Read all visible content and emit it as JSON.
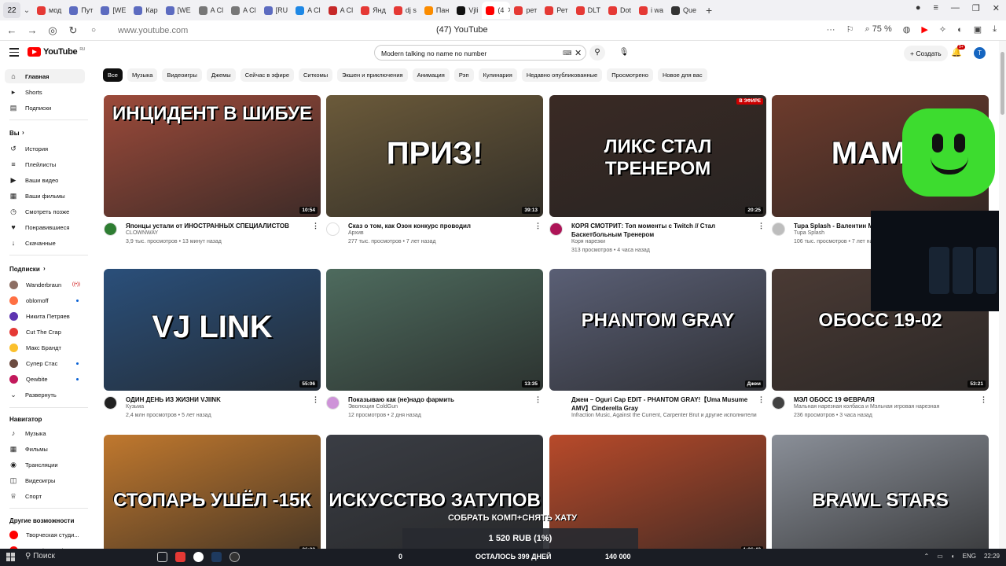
{
  "tabs": {
    "count": "22",
    "items": [
      {
        "label": "мод",
        "color": "#e53935"
      },
      {
        "label": "Пут",
        "color": "#5c6bc0"
      },
      {
        "label": "[WE",
        "color": "#5c6bc0"
      },
      {
        "label": "Кар",
        "color": "#5c6bc0"
      },
      {
        "label": "[WE",
        "color": "#5c6bc0"
      },
      {
        "label": "A Cl",
        "color": "#777777"
      },
      {
        "label": "A Cl",
        "color": "#777777"
      },
      {
        "label": "[RU",
        "color": "#5c6bc0"
      },
      {
        "label": "A Cl",
        "color": "#1e88e5"
      },
      {
        "label": "A Cl",
        "color": "#c62828"
      },
      {
        "label": "Янд",
        "color": "#e53935"
      },
      {
        "label": "dj s",
        "color": "#e53935"
      },
      {
        "label": "Пан",
        "color": "#fb8c00"
      },
      {
        "label": "Vjli",
        "color": "#111111"
      }
    ],
    "active": {
      "label": "(4",
      "color": "#ff0000"
    },
    "after": [
      {
        "label": "рет",
        "color": "#e53935"
      },
      {
        "label": "Рет",
        "color": "#e53935"
      },
      {
        "label": "DLT",
        "color": "#e53935"
      },
      {
        "label": "Dot",
        "color": "#e53935"
      },
      {
        "label": "i wa",
        "color": "#e53935"
      },
      {
        "label": "Que",
        "color": "#333333"
      }
    ]
  },
  "browser": {
    "url": "www.youtube.com",
    "page_title": "(47) YouTube",
    "zoom": "75 %",
    "bookmark_icon": "bookmark-icon"
  },
  "youtube": {
    "logo_text": "YouTube",
    "region": "RU",
    "search_value": "Modern talking no name no number",
    "create_label": "Создать",
    "notifications": "9+",
    "avatar_letter": "T"
  },
  "sidebar": {
    "main": [
      {
        "label": "Главная",
        "icon": "home-icon",
        "glyph": "⌂"
      },
      {
        "label": "Shorts",
        "icon": "shorts-icon",
        "glyph": "▸"
      },
      {
        "label": "Подписки",
        "icon": "subscriptions-icon",
        "glyph": "▤"
      }
    ],
    "you_title": "Вы",
    "you": [
      {
        "label": "История",
        "icon": "history-icon",
        "glyph": "↺"
      },
      {
        "label": "Плейлисты",
        "icon": "playlists-icon",
        "glyph": "≡"
      },
      {
        "label": "Ваши видео",
        "icon": "your-videos-icon",
        "glyph": "▶"
      },
      {
        "label": "Ваши фильмы",
        "icon": "your-movies-icon",
        "glyph": "▦"
      },
      {
        "label": "Смотреть позже",
        "icon": "watch-later-icon",
        "glyph": "◷"
      },
      {
        "label": "Понравившиеся",
        "icon": "like-icon",
        "glyph": "♥"
      },
      {
        "label": "Скачанные",
        "icon": "download-icon",
        "glyph": "↓"
      }
    ],
    "subs_title": "Подписки",
    "subs": [
      {
        "label": "Wanderbraun",
        "color": "#8d6e63",
        "status": "live"
      },
      {
        "label": "oblomoff",
        "color": "#ff7043",
        "status": "new"
      },
      {
        "label": "Никита Петряев",
        "color": "#5e35b1",
        "status": ""
      },
      {
        "label": "Cut The Crap",
        "color": "#e53935",
        "status": ""
      },
      {
        "label": "Макс Брандт",
        "color": "#fbc02d",
        "status": ""
      },
      {
        "label": "Супер Стас",
        "color": "#6d4c41",
        "status": "new"
      },
      {
        "label": "Qewbite",
        "color": "#c2185b",
        "status": "new"
      }
    ],
    "expand_label": "Развернуть",
    "nav_title": "Навигатор",
    "nav": [
      {
        "label": "Музыка",
        "icon": "music-icon",
        "glyph": "♪"
      },
      {
        "label": "Фильмы",
        "icon": "movies-icon",
        "glyph": "▦"
      },
      {
        "label": "Трансляции",
        "icon": "live-icon",
        "glyph": "◉"
      },
      {
        "label": "Видеоигры",
        "icon": "gaming-icon",
        "glyph": "◫"
      },
      {
        "label": "Спорт",
        "icon": "sport-icon",
        "glyph": "♕"
      }
    ],
    "more_title": "Другие возможности",
    "more": [
      {
        "label": "Творческая студи...",
        "color": "#ff0000"
      },
      {
        "label": "YouTube Music",
        "color": "#ff0000"
      }
    ]
  },
  "chips": [
    "Все",
    "Музыка",
    "Видеоигры",
    "Джемы",
    "Сейчас в эфире",
    "Ситкомы",
    "Экшен и приключения",
    "Анимация",
    "Рэп",
    "Кулинария",
    "Недавно опубликованные",
    "Просмотрено",
    "Новое для вас"
  ],
  "videos": [
    {
      "title": "Японцы устали от ИНОСТРАННЫХ СПЕЦИАЛИСТОВ",
      "channel": "CLOWNWAY",
      "stats": "3,9 тыс. просмотров • 13 минут назад",
      "duration": "10:54",
      "thumb_text": "ИНЦИДЕНТ В ШИБУЕ",
      "bg": "#9c4a3a",
      "avatar": "#2e7d32"
    },
    {
      "title": "Сказ о том, как Озон конкурс проводил",
      "channel": "Архив",
      "stats": "277 тыс. просмотров • 7 лет назад",
      "duration": "39:13",
      "thumb_text": "ПРИЗ!",
      "bg": "#6b5a3a",
      "avatar": "#ffffff"
    },
    {
      "title": "КОРЯ СМОТРИТ: Топ моменты с Twitch // Стал Баскетбольным Тренером",
      "channel": "Коря нарезки",
      "stats": "313 просмотров • 4 часа назад",
      "duration": "20:25",
      "thumb_text": "ЛИКС СТАЛ ТРЕНЕРОМ",
      "bg": "#3a2a24",
      "avatar": "#ad1457",
      "live": "В ЭФИРЕ"
    },
    {
      "title": "Tupa Splash - Валентин Мам",
      "channel": "Tupa Splash",
      "stats": "106 тыс. просмотров • 7 лет наз",
      "duration": "",
      "thumb_text": "МАМА",
      "bg": "#6d3b2c",
      "avatar": "#bdbdbd"
    },
    {
      "title": "ОДИН ДЕНЬ ИЗ ЖИЗНИ VJIINK",
      "channel": "Кузьма",
      "stats": "2,4 млн просмотров • 5 лет назад",
      "duration": "55:06",
      "thumb_text": "VJ LINK",
      "bg": "#2a4f7a",
      "avatar": "#212121"
    },
    {
      "title": "Показываю как (не)надо фармить",
      "channel": "Эволюция ColdGun",
      "stats": "12 просмотров • 2 дня назад",
      "duration": "13:35",
      "thumb_text": "",
      "bg": "#4e6b5e",
      "avatar": "#ce93d8"
    },
    {
      "title": "Джем – Oguri Cap EDIT - PHANTOM GRAY!【Uma Musume AMV】Cinderella Gray",
      "channel": "Infraction Music, Against the Current, Carpenter Brut и другие исполнители",
      "stats": "",
      "duration": "Джем",
      "thumb_text": "PHANTOM GRAY",
      "bg": "#5a5f75",
      "avatar": ""
    },
    {
      "title": "МЭЛ ОБОСС 19 ФЕВРАЛЯ",
      "channel": "Мальная нарезная колбаса и Мэльная игровая нарезная",
      "stats": "236 просмотров • 3 часа назад",
      "duration": "53:21",
      "thumb_text": "ОБОСС 19-02",
      "bg": "#4a3a34",
      "avatar": "#424242"
    },
    {
      "title": "",
      "channel": "",
      "stats": "",
      "duration": "26:22",
      "thumb_text": "СТОПАРЬ УШЁЛ -15К",
      "bg": "#c0782e",
      "avatar": ""
    },
    {
      "title": "",
      "channel": "",
      "stats": "",
      "duration": "",
      "thumb_text": "ИСКУССТВО ЗАТУПОВ",
      "bg": "#3a3d44",
      "avatar": ""
    },
    {
      "title": "",
      "channel": "",
      "stats": "",
      "duration": "1:26:42",
      "thumb_text": "",
      "bg": "#b84a2a",
      "avatar": ""
    },
    {
      "title": "",
      "channel": "",
      "stats": "",
      "duration": "",
      "thumb_text": "BRAWL STARS",
      "bg": "#8a8f98",
      "avatar": ""
    }
  ],
  "overlay": {
    "caption": "СОБРАТЬ КОМП+СНЯТЬ ХАТУ",
    "donation": "1 520 RUB (1%)",
    "left_value": "0",
    "days_left": "ОСТАЛОСЬ 399 ДНЕЙ",
    "goal": "140 000"
  },
  "taskbar": {
    "search_label": "Поиск",
    "lang": "ENG",
    "time": "22:29"
  }
}
